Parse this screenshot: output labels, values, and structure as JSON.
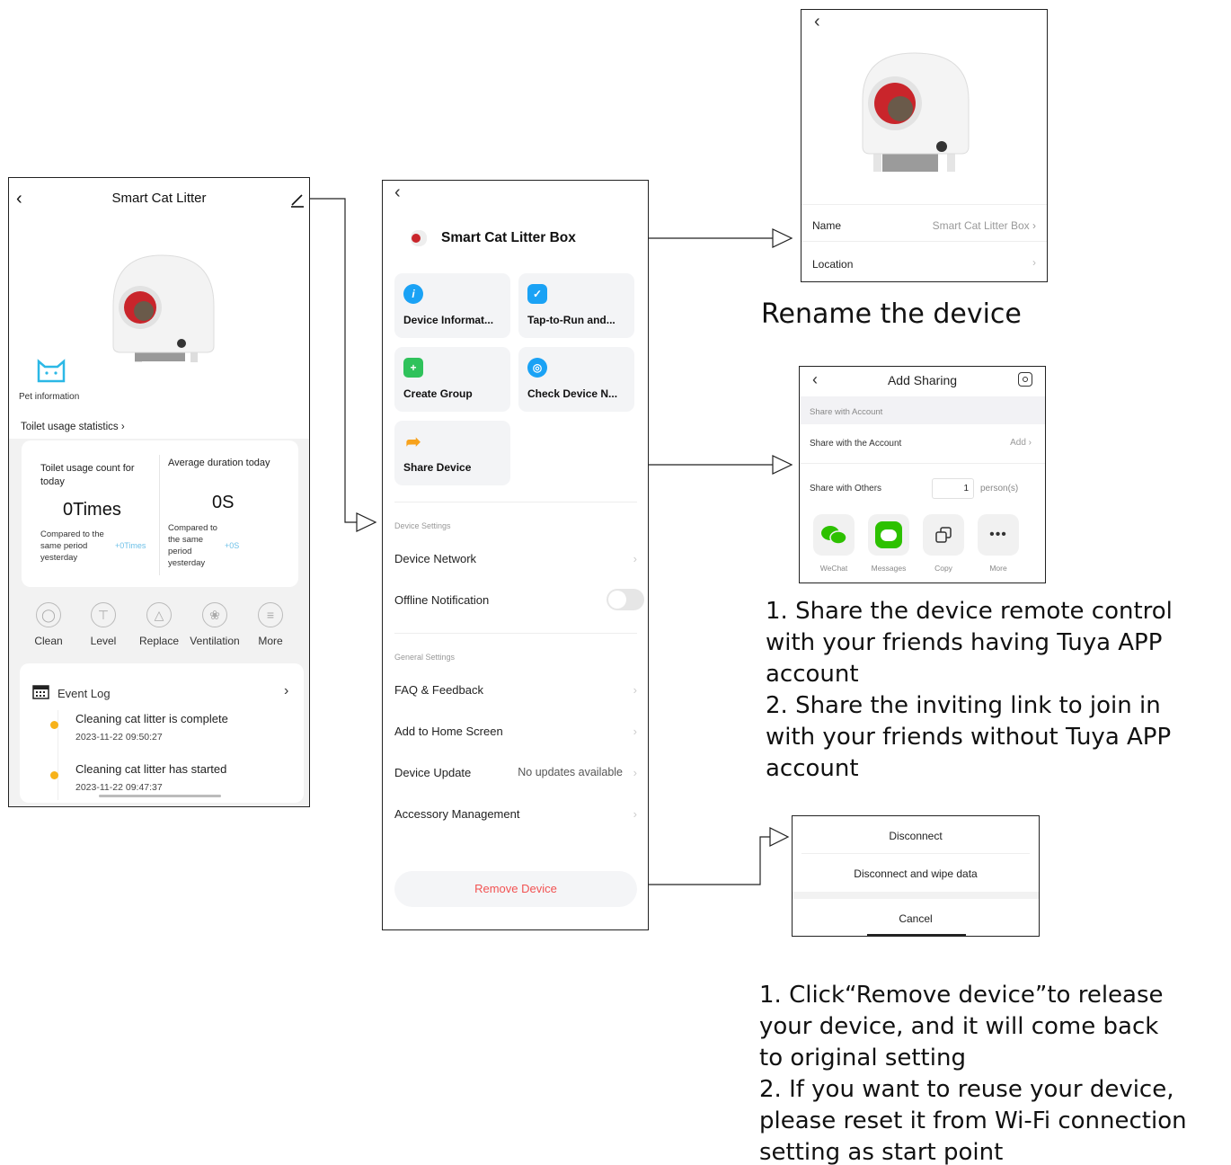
{
  "phone_home": {
    "title": "Smart Cat Litter",
    "pet_info_label": "Pet information",
    "usage_stats_link": "Toilet usage statistics",
    "usage_count": {
      "label": "Toilet usage count for today",
      "value": "0Times",
      "compare_label": "Compared to the same period yesterday",
      "delta": "+0Times"
    },
    "avg_duration": {
      "label": "Average duration today",
      "value": "0S",
      "compare_label": "Compared to the same period yesterday",
      "delta": "+0S"
    },
    "controls": [
      {
        "label": "Clean",
        "icon": "clean-icon"
      },
      {
        "label": "Level",
        "icon": "level-icon"
      },
      {
        "label": "Replace",
        "icon": "replace-icon"
      },
      {
        "label": "Ventilation",
        "icon": "ventilation-icon"
      },
      {
        "label": "More",
        "icon": "more-list-icon"
      }
    ],
    "event_log": {
      "title": "Event Log",
      "events": [
        {
          "text": "Cleaning cat litter is complete",
          "time": "2023-11-22 09:50:27"
        },
        {
          "text": "Cleaning cat litter has started",
          "time": "2023-11-22 09:47:37"
        }
      ]
    }
  },
  "phone_settings": {
    "device_name": "Smart Cat Litter Box",
    "tiles": [
      {
        "label": "Device Informat...",
        "icon": "info-icon",
        "color": "#1aa2f5"
      },
      {
        "label": "Tap-to-Run and...",
        "icon": "automation-icon",
        "color": "#1aa2f5"
      },
      {
        "label": "Create Group",
        "icon": "group-icon",
        "color": "#2fc25b"
      },
      {
        "label": "Check Device N...",
        "icon": "network-check-icon",
        "color": "#1aa2f5"
      },
      {
        "label": "Share Device",
        "icon": "share-arrow-icon",
        "color": "#f7a21c"
      }
    ],
    "device_settings_label": "Device Settings",
    "device_network": "Device Network",
    "offline_notification": "Offline Notification",
    "offline_enabled": false,
    "general_settings_label": "General Settings",
    "faq": "FAQ & Feedback",
    "add_home": "Add to Home Screen",
    "device_update": "Device Update",
    "update_status": "No updates available",
    "accessory": "Accessory Management",
    "remove_device": "Remove Device",
    "remove_color": "#f25252"
  },
  "phone_rename": {
    "name_label": "Name",
    "name_value": "Smart Cat Litter Box",
    "location_label": "Location"
  },
  "phone_sharing": {
    "title": "Add Sharing",
    "section_label": "Share with Account",
    "share_account_label": "Share with the Account",
    "add_label": "Add",
    "share_others_label": "Share with Others",
    "persons_count": "1",
    "persons_unit": "person(s)",
    "apps": [
      {
        "label": "WeChat",
        "icon": "wechat-icon"
      },
      {
        "label": "Messages",
        "icon": "messages-icon"
      },
      {
        "label": "Copy",
        "icon": "copy-icon"
      },
      {
        "label": "More",
        "icon": "more-dots-icon"
      }
    ]
  },
  "sheet_remove": {
    "disconnect": "Disconnect",
    "disconnect_wipe": "Disconnect and wipe data",
    "cancel": "Cancel"
  },
  "captions": {
    "rename": "Rename the device",
    "share": "1. Share the device remote control\nwith your friends having Tuya APP\naccount\n2. Share the inviting link to join in\nwith your friends without Tuya APP\naccount",
    "remove": "1. Click“Remove device”to release\nyour device, and it will come back\nto original setting\n2. If you want to reuse your device,\nplease reset it from Wi-Fi connection\nsetting as start point"
  }
}
